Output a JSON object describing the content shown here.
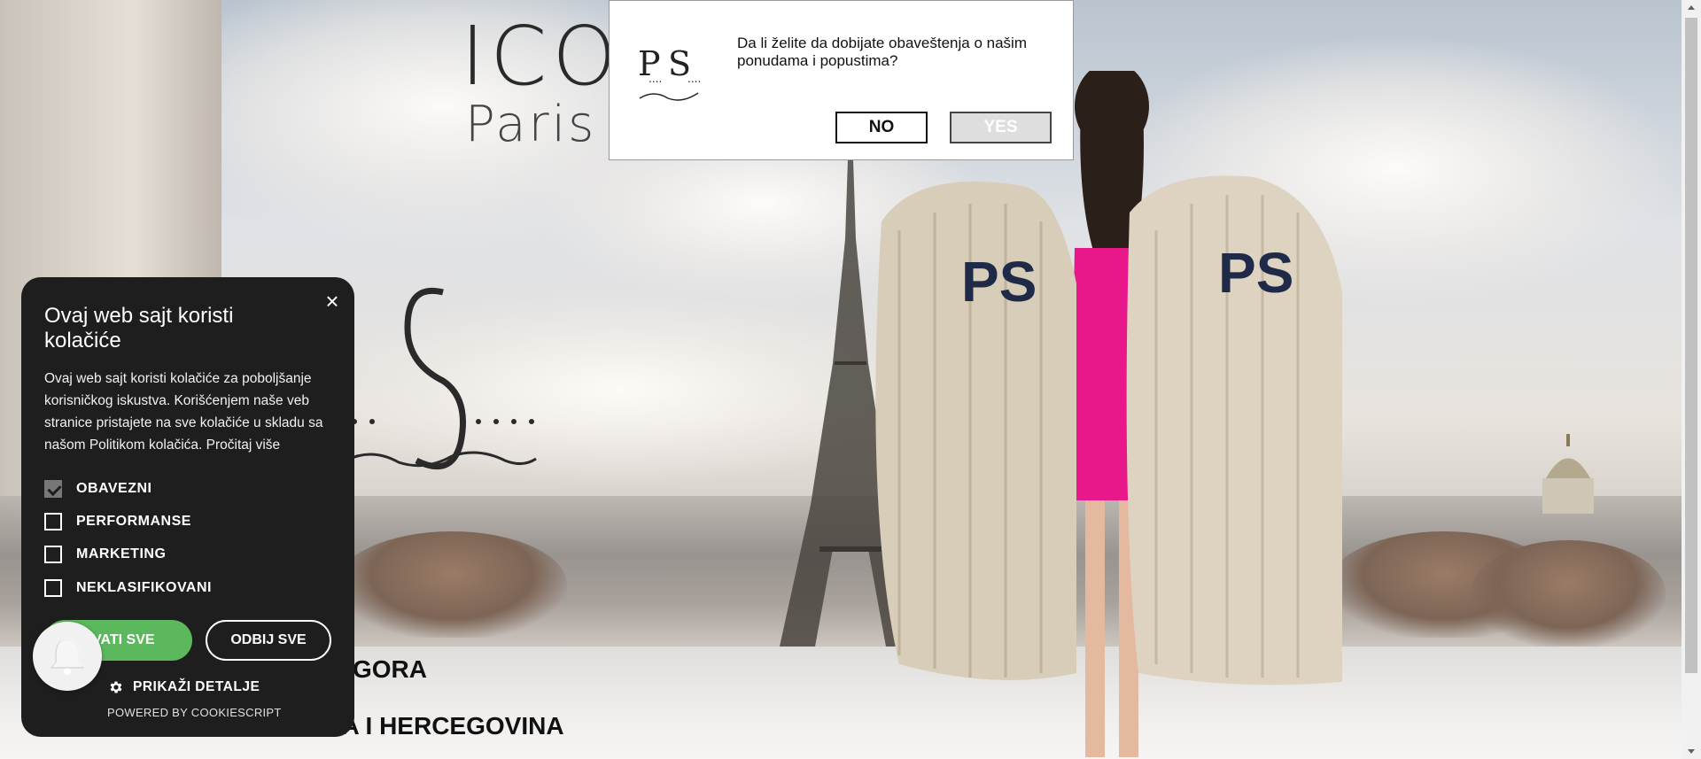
{
  "hero": {
    "brand_title": "ICO",
    "brand_subtitle": "Paris e",
    "countries": [
      "GORA",
      "B    NA I HERCEGOVINA"
    ]
  },
  "push_prompt": {
    "message": "Da li želite da dobijate obaveštenja o našim ponudama i popustima?",
    "no_label": "NO",
    "yes_label": "YES"
  },
  "cookie_banner": {
    "close_label": "×",
    "title": "Ovaj web sajt koristi kolačiće",
    "body": "Ovaj web sajt koristi kolačiće za poboljšanje korisničkog iskustva. Korišćenjem naše veb stranice pristajete na sve kolačiće u skladu sa našom Politikom kolačića. Pročitaj više",
    "options": [
      {
        "label": "OBAVEZNI",
        "checked": true
      },
      {
        "label": "PERFORMANSE",
        "checked": false
      },
      {
        "label": "MARKETING",
        "checked": false
      },
      {
        "label": "NEKLASIFIKOVANI",
        "checked": false
      }
    ],
    "accept_label": "HVATI SVE",
    "reject_label": "ODBIJ SVE",
    "details_label": "PRIKAŽI DETALJE",
    "powered_by": "POWERED BY COOKIESCRIPT"
  },
  "colors": {
    "accept_green": "#5cb85c",
    "panel_bg": "#1e1e1e",
    "dress_pink": "#e8188a"
  }
}
